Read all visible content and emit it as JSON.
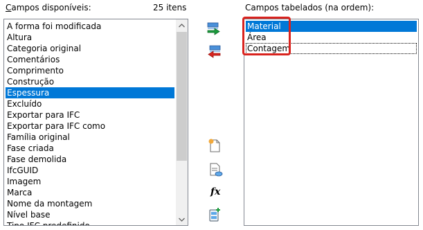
{
  "available": {
    "label_prefix": "C",
    "label_rest": "ampos disponíveis:",
    "count": "25 itens",
    "items": [
      "A forma foi modificada",
      "Altura",
      "Categoria original",
      "Comentários",
      "Comprimento",
      "Construção",
      "Espessura",
      "Excluído",
      "Exportar para IFC",
      "Exportar para IFC como",
      "Família original",
      "Fase criada",
      "Fase demolida",
      "IfcGUID",
      "Imagem",
      "Marca",
      "Nome da montagem",
      "Nível base",
      "Tipo IFC predefinido"
    ],
    "selected_index": 6
  },
  "scheduled": {
    "label_prefix": "Campos tabelados (na ordem)",
    "label_rest": ":",
    "items": [
      "Material",
      "Área",
      "Contagem"
    ],
    "selected_index": 0
  },
  "tools": {
    "add": "add-parameter-icon",
    "remove": "remove-parameter-icon",
    "new_parameter": "new-parameter-icon",
    "edit_parameter": "edit-parameter-icon",
    "formula": "formula-icon",
    "combine": "combine-parameters-icon",
    "formula_glyph": "fx"
  },
  "colors": {
    "selection": "#0078d7",
    "highlight_box": "#d9231e",
    "add_arrow": "#1a9b3c",
    "remove_arrow": "#d9231e"
  }
}
